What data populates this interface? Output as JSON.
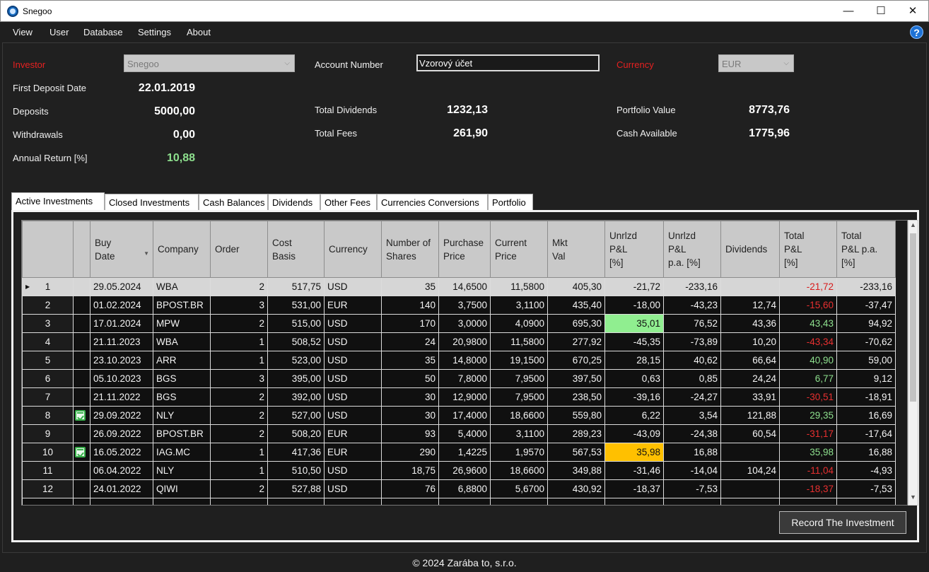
{
  "window": {
    "title": "Snegoo",
    "minimize": "—",
    "maximize": "☐",
    "close": "✕"
  },
  "menu": {
    "items": [
      "View",
      "User",
      "Database",
      "Settings",
      "About"
    ],
    "help": "?"
  },
  "summary": {
    "investor_label": "Investor",
    "investor_value": "Snegoo",
    "first_deposit_label": "First Deposit Date",
    "first_deposit_value": "22.01.2019",
    "deposits_label": "Deposits",
    "deposits_value": "5000,00",
    "withdrawals_label": "Withdrawals",
    "withdrawals_value": "0,00",
    "annual_return_label": "Annual Return [%]",
    "annual_return_value": "10,88",
    "account_number_label": "Account Number",
    "account_number_value": "Vzorový účet",
    "total_dividends_label": "Total Dividends",
    "total_dividends_value": "1232,13",
    "total_fees_label": "Total Fees",
    "total_fees_value": "261,90",
    "currency_label": "Currency",
    "currency_value": "EUR",
    "portfolio_value_label": "Portfolio Value",
    "portfolio_value_value": "8773,76",
    "cash_available_label": "Cash Available",
    "cash_available_value": "1775,96"
  },
  "tabs": [
    "Active Investments",
    "Closed Investments",
    "Cash Balances",
    "Dividends",
    "Other Fees",
    "Currencies Conversions",
    "Portfolio"
  ],
  "grid": {
    "columns": [
      "",
      "",
      "Buy Date",
      "Company",
      "Order",
      "Cost Basis",
      "Currency",
      "Number of Shares",
      "Purchase Price",
      "Current Price",
      "Mkt Val",
      "Unrlzd P&L [%]",
      "Unrlzd P&L p.a. [%]",
      "Dividends",
      "Total P&L [%]",
      "Total P&L p.a. [%]"
    ],
    "rows": [
      {
        "n": "1",
        "icon": false,
        "date": "29.05.2024",
        "company": "WBA",
        "order": "2",
        "cost": "517,75",
        "cur": "USD",
        "shares": "35",
        "pprice": "14,6500",
        "cprice": "11,5800",
        "mkt": "405,30",
        "upl": "-21,72",
        "uplpa": "-233,16",
        "div": "",
        "tpl": "-21,72",
        "tplpa": "-233,16"
      },
      {
        "n": "2",
        "icon": false,
        "date": "01.02.2024",
        "company": "BPOST.BR",
        "order": "3",
        "cost": "531,00",
        "cur": "EUR",
        "shares": "140",
        "pprice": "3,7500",
        "cprice": "3,1100",
        "mkt": "435,40",
        "upl": "-18,00",
        "uplpa": "-43,23",
        "div": "12,74",
        "tpl": "-15,60",
        "tplpa": "-37,47"
      },
      {
        "n": "3",
        "icon": false,
        "date": "17.01.2024",
        "company": "MPW",
        "order": "2",
        "cost": "515,00",
        "cur": "USD",
        "shares": "170",
        "pprice": "3,0000",
        "cprice": "4,0900",
        "mkt": "695,30",
        "upl": "35,01",
        "uplpa": "76,52",
        "div": "43,36",
        "tpl": "43,43",
        "tplpa": "94,92"
      },
      {
        "n": "4",
        "icon": false,
        "date": "21.11.2023",
        "company": "WBA",
        "order": "1",
        "cost": "508,52",
        "cur": "USD",
        "shares": "24",
        "pprice": "20,9800",
        "cprice": "11,5800",
        "mkt": "277,92",
        "upl": "-45,35",
        "uplpa": "-73,89",
        "div": "10,20",
        "tpl": "-43,34",
        "tplpa": "-70,62"
      },
      {
        "n": "5",
        "icon": false,
        "date": "23.10.2023",
        "company": "ARR",
        "order": "1",
        "cost": "523,00",
        "cur": "USD",
        "shares": "35",
        "pprice": "14,8000",
        "cprice": "19,1500",
        "mkt": "670,25",
        "upl": "28,15",
        "uplpa": "40,62",
        "div": "66,64",
        "tpl": "40,90",
        "tplpa": "59,00"
      },
      {
        "n": "6",
        "icon": false,
        "date": "05.10.2023",
        "company": "BGS",
        "order": "3",
        "cost": "395,00",
        "cur": "USD",
        "shares": "50",
        "pprice": "7,8000",
        "cprice": "7,9500",
        "mkt": "397,50",
        "upl": "0,63",
        "uplpa": "0,85",
        "div": "24,24",
        "tpl": "6,77",
        "tplpa": "9,12"
      },
      {
        "n": "7",
        "icon": false,
        "date": "21.11.2022",
        "company": "BGS",
        "order": "2",
        "cost": "392,00",
        "cur": "USD",
        "shares": "30",
        "pprice": "12,9000",
        "cprice": "7,9500",
        "mkt": "238,50",
        "upl": "-39,16",
        "uplpa": "-24,27",
        "div": "33,91",
        "tpl": "-30,51",
        "tplpa": "-18,91"
      },
      {
        "n": "8",
        "icon": true,
        "date": "29.09.2022",
        "company": "NLY",
        "order": "2",
        "cost": "527,00",
        "cur": "USD",
        "shares": "30",
        "pprice": "17,4000",
        "cprice": "18,6600",
        "mkt": "559,80",
        "upl": "6,22",
        "uplpa": "3,54",
        "div": "121,88",
        "tpl": "29,35",
        "tplpa": "16,69"
      },
      {
        "n": "9",
        "icon": false,
        "date": "26.09.2022",
        "company": "BPOST.BR",
        "order": "2",
        "cost": "508,20",
        "cur": "EUR",
        "shares": "93",
        "pprice": "5,4000",
        "cprice": "3,1100",
        "mkt": "289,23",
        "upl": "-43,09",
        "uplpa": "-24,38",
        "div": "60,54",
        "tpl": "-31,17",
        "tplpa": "-17,64"
      },
      {
        "n": "10",
        "icon": true,
        "date": "16.05.2022",
        "company": "IAG.MC",
        "order": "1",
        "cost": "417,36",
        "cur": "EUR",
        "shares": "290",
        "pprice": "1,4225",
        "cprice": "1,9570",
        "mkt": "567,53",
        "upl": "35,98",
        "uplpa": "16,88",
        "div": "",
        "tpl": "35,98",
        "tplpa": "16,88"
      },
      {
        "n": "11",
        "icon": false,
        "date": "06.04.2022",
        "company": "NLY",
        "order": "1",
        "cost": "510,50",
        "cur": "USD",
        "shares": "18,75",
        "pprice": "26,9600",
        "cprice": "18,6600",
        "mkt": "349,88",
        "upl": "-31,46",
        "uplpa": "-14,04",
        "div": "104,24",
        "tpl": "-11,04",
        "tplpa": "-4,93"
      },
      {
        "n": "12",
        "icon": false,
        "date": "24.01.2022",
        "company": "QIWI",
        "order": "2",
        "cost": "527,88",
        "cur": "USD",
        "shares": "76",
        "pprice": "6,8800",
        "cprice": "5,6700",
        "mkt": "430,92",
        "upl": "-18,37",
        "uplpa": "-7,53",
        "div": "",
        "tpl": "-18,37",
        "tplpa": "-7,53"
      }
    ]
  },
  "record_button": "Record The Investment",
  "footer": "© 2024 Zarába to, s.r.o.",
  "colors": {
    "negative": "#e83030",
    "positive": "#8ee08e",
    "highlight_best": "#90ee90",
    "highlight_second": "#ffc000",
    "label_required": "#e62020"
  }
}
